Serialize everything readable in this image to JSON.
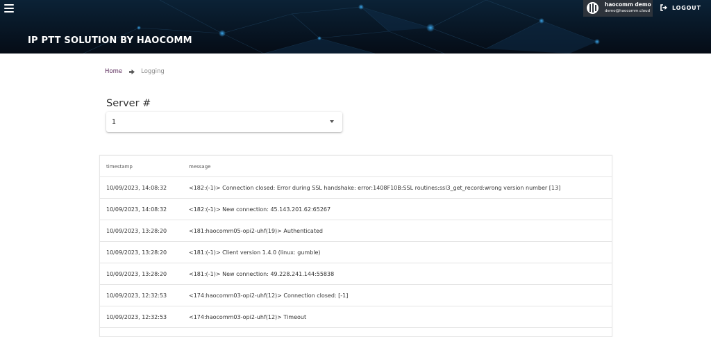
{
  "header": {
    "title": "IP PTT SOLUTION BY HAOCOMM",
    "user": {
      "name": "haocomm demo",
      "email": "demo@haocomm.cloud"
    },
    "logout_label": "LOGOUT"
  },
  "breadcrumb": {
    "home": "Home",
    "current": "Logging"
  },
  "server": {
    "label": "Server #",
    "selected": "1"
  },
  "table": {
    "columns": {
      "timestamp": "timestamp",
      "message": "message"
    },
    "rows": [
      {
        "timestamp": "10/09/2023, 14:08:32",
        "message": "<182:(-1)> Connection closed: Error during SSL handshake: error:1408F10B:SSL routines:ssl3_get_record:wrong version number [13]"
      },
      {
        "timestamp": "10/09/2023, 14:08:32",
        "message": "<182:(-1)> New connection: 45.143.201.62:65267"
      },
      {
        "timestamp": "10/09/2023, 13:28:20",
        "message": "<181:haocomm05-opi2-uhf(19)> Authenticated"
      },
      {
        "timestamp": "10/09/2023, 13:28:20",
        "message": "<181:(-1)> Client version 1.4.0 (linux: gumble)"
      },
      {
        "timestamp": "10/09/2023, 13:28:20",
        "message": "<181:(-1)> New connection: 49.228.241.144:55838"
      },
      {
        "timestamp": "10/09/2023, 12:32:53",
        "message": "<174:haocomm03-opi2-uhf(12)> Connection closed: [-1]"
      },
      {
        "timestamp": "10/09/2023, 12:32:53",
        "message": "<174:haocomm03-opi2-uhf(12)> Timeout"
      }
    ]
  },
  "icons": {
    "menu": "hamburger-menu-icon",
    "avatar": "user-avatar-icon",
    "logout": "logout-icon",
    "breadcrumb_separator": "arrow-right-icon",
    "select": "caret-down-icon"
  },
  "colors": {
    "header_bg": "#081322",
    "user_box_bg": "#2d333b",
    "breadcrumb_link": "#5a2a5a"
  }
}
